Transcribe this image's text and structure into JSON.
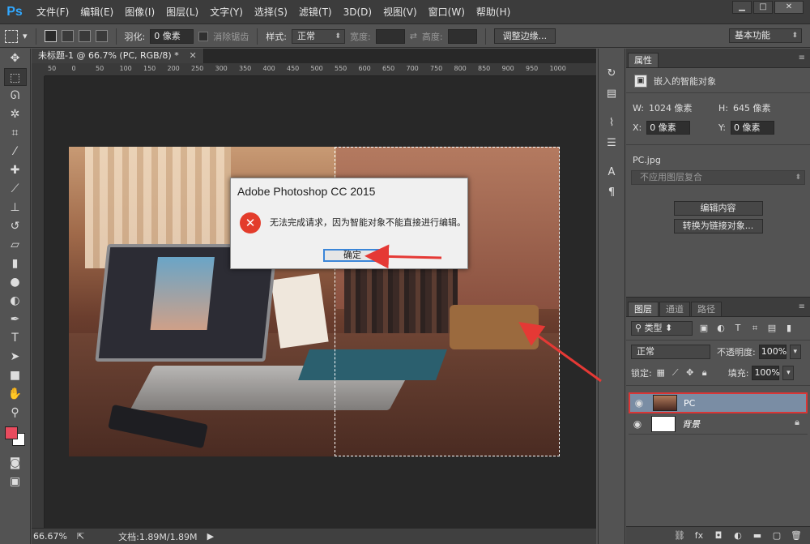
{
  "app": {
    "menu": [
      "文件(F)",
      "编辑(E)",
      "图像(I)",
      "图层(L)",
      "文字(Y)",
      "选择(S)",
      "滤镜(T)",
      "3D(D)",
      "视图(V)",
      "窗口(W)",
      "帮助(H)"
    ],
    "logo": "Ps"
  },
  "options": {
    "feather_label": "羽化:",
    "feather_value": "0 像素",
    "antialias_label": "消除锯齿",
    "style_label": "样式:",
    "style_value": "正常",
    "width_label": "宽度:",
    "height_label": "高度:",
    "refine_edge": "调整边缘...",
    "workspace": "基本功能"
  },
  "document": {
    "tab_title": "未标题-1 @ 66.7% (PC, RGB/8) *",
    "ruler_ticks": [
      "50",
      "0",
      "50",
      "100",
      "150",
      "200",
      "250",
      "300",
      "350",
      "400",
      "450",
      "500",
      "550",
      "600",
      "650",
      "700",
      "750",
      "800",
      "850",
      "900",
      "950",
      "1000"
    ],
    "zoom": "66.67%",
    "doc_size": "文档:1.89M/1.89M"
  },
  "dialog": {
    "title": "Adobe Photoshop CC 2015",
    "message": "无法完成请求，因为智能对象不能直接进行编辑。",
    "ok": "确定"
  },
  "properties": {
    "tab": "属性",
    "type": "嵌入的智能对象",
    "w_label": "W:",
    "w_value": "1024 像素",
    "h_label": "H:",
    "h_value": "645 像素",
    "x_label": "X:",
    "x_value": "0 像素",
    "y_label": "Y:",
    "y_value": "0 像素",
    "filename": "PC.jpg",
    "layer_comp": "不应用图层复合",
    "edit_contents": "编辑内容",
    "convert_linked": "转换为链接对象..."
  },
  "layers": {
    "tabs": [
      "图层",
      "通道",
      "路径"
    ],
    "filter_kind": "类型",
    "blend_mode": "正常",
    "opacity_label": "不透明度:",
    "opacity_value": "100%",
    "lock_label": "锁定:",
    "fill_label": "填充:",
    "fill_value": "100%",
    "items": [
      {
        "name": "PC",
        "selected": true
      },
      {
        "name": "背景",
        "selected": false
      }
    ]
  },
  "colors": {
    "foreground": "#e94b5e",
    "background": "#ffffff",
    "highlight_border": "#d93636",
    "arrow": "#e53935"
  }
}
